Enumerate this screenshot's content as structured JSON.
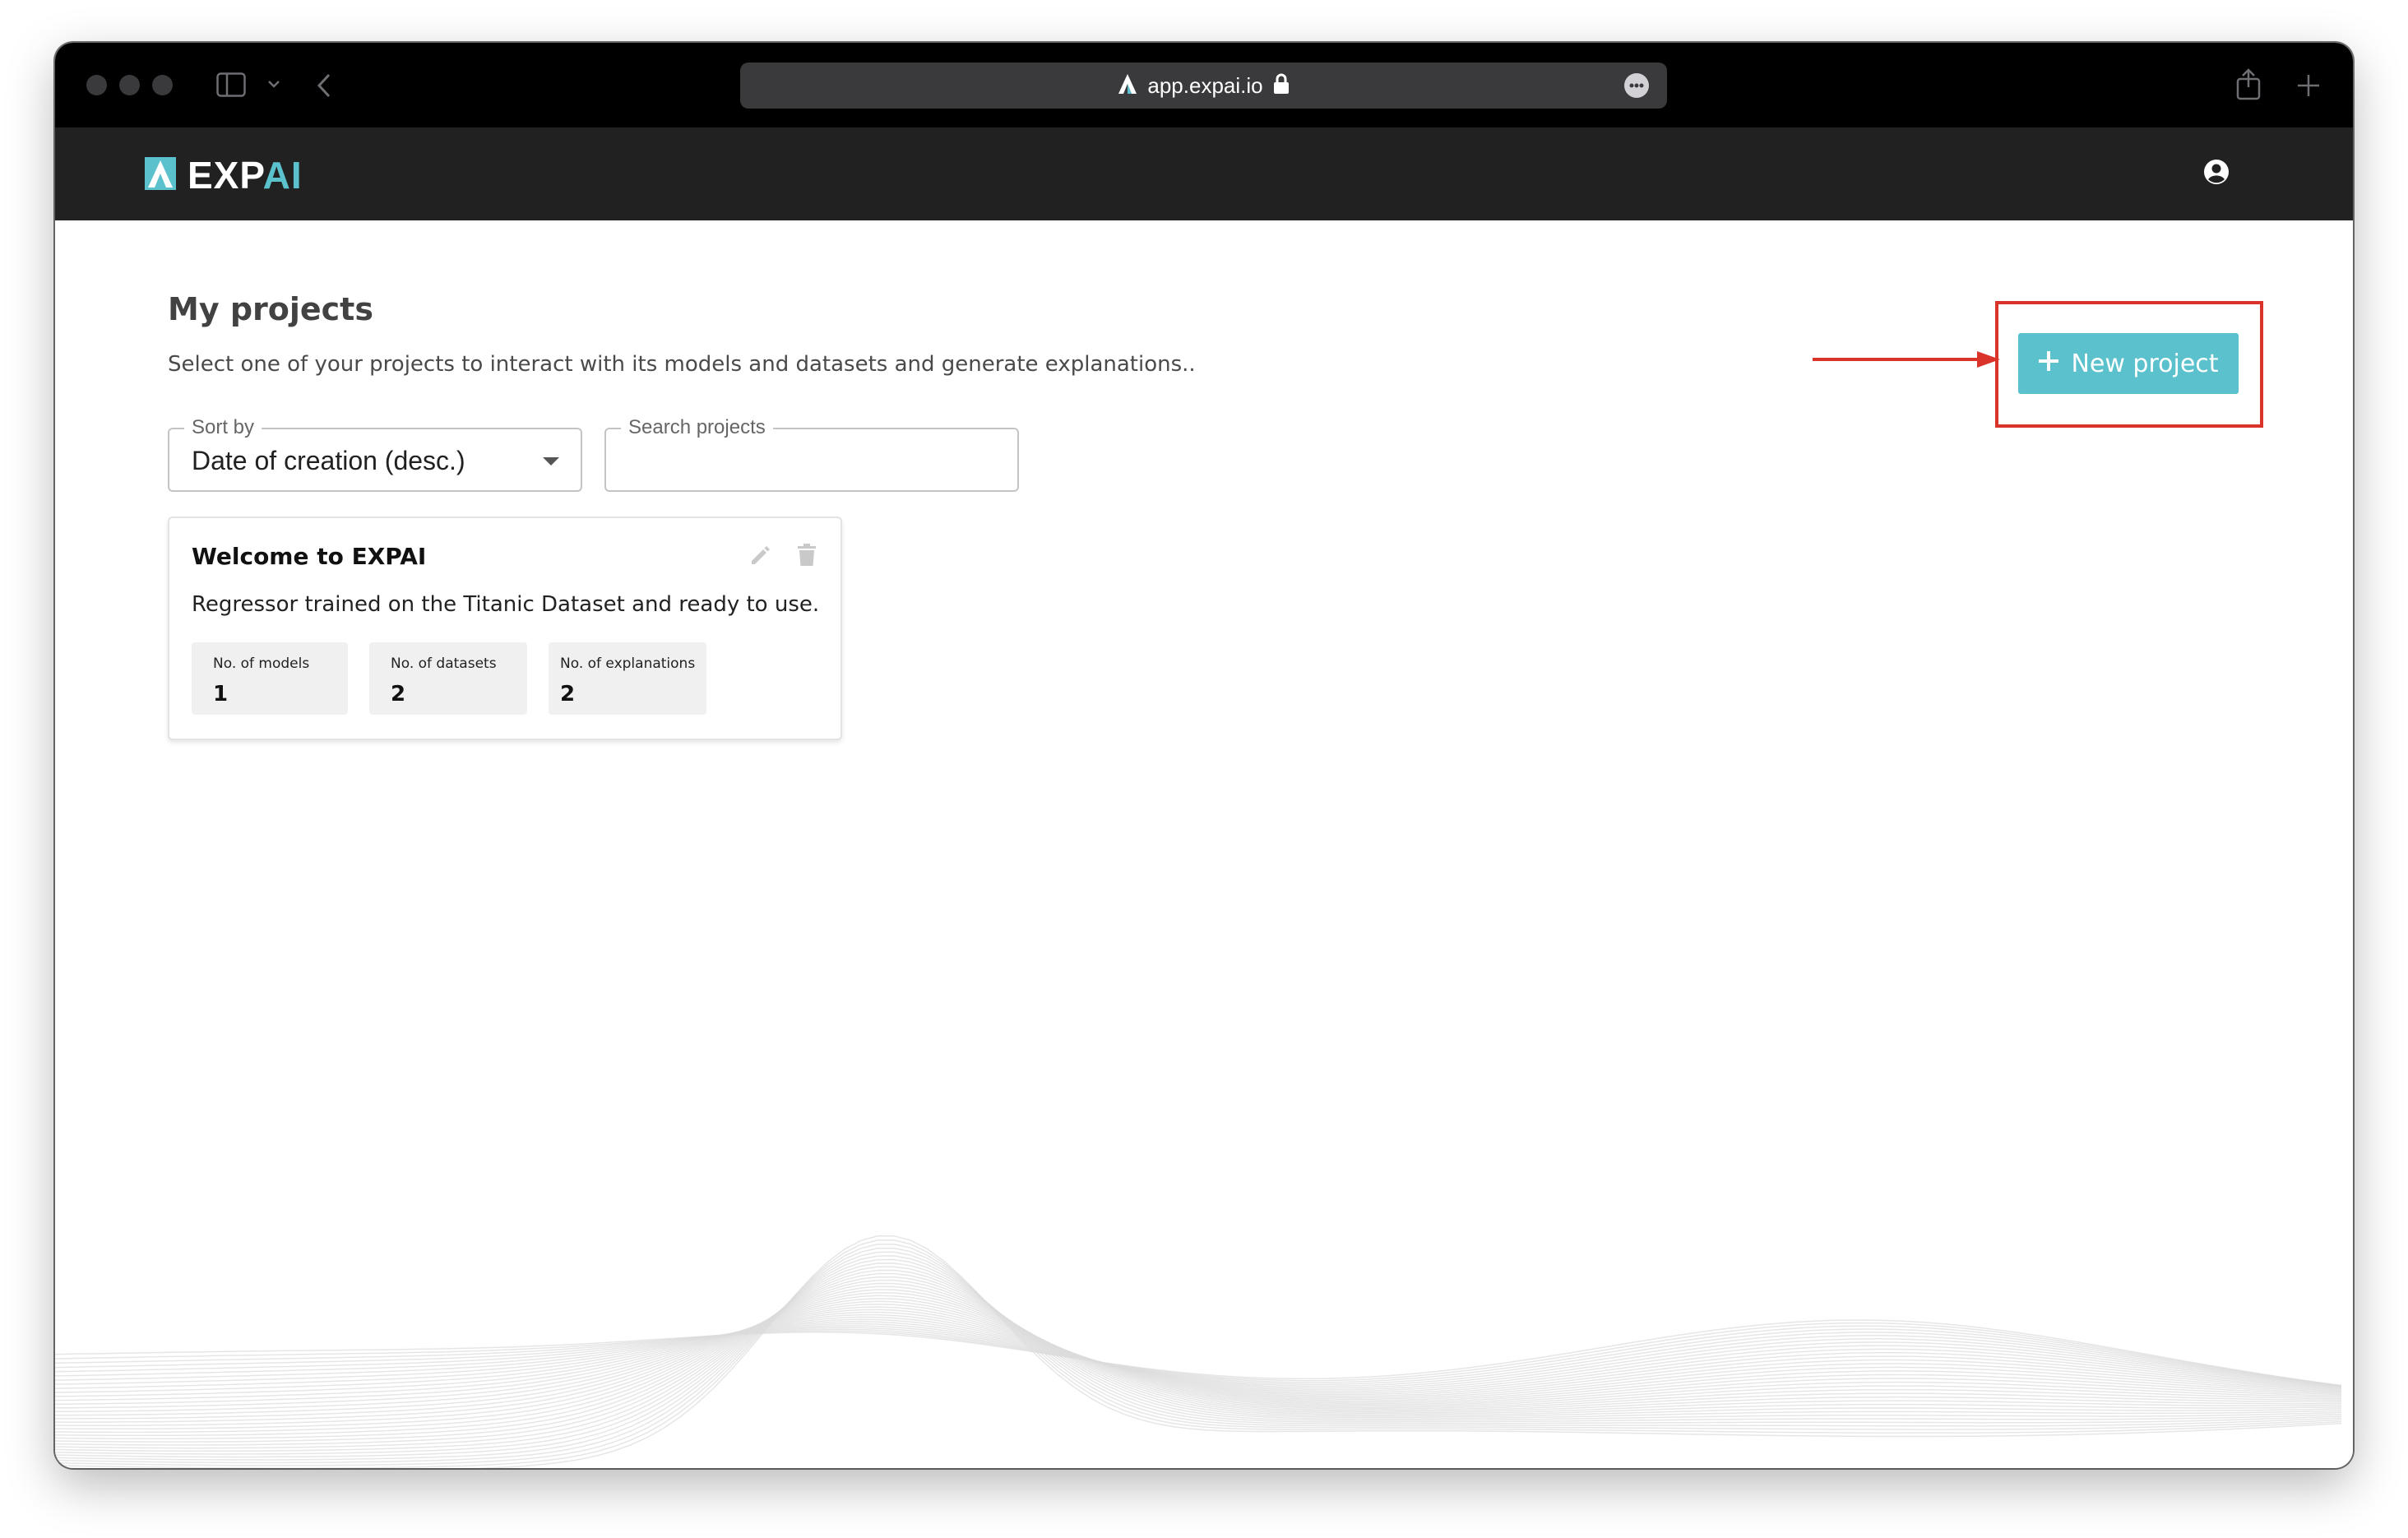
{
  "browser": {
    "url": "app.expai.io"
  },
  "app": {
    "logo_prefix": "EXP",
    "logo_accent": "AI",
    "brand_color": "#5bc1cc",
    "header_color": "#212121",
    "user_icon": "account-circle-icon"
  },
  "page": {
    "title": "My projects",
    "subtitle": "Select one of your projects to interact with its models and datasets and generate explanations.."
  },
  "controls": {
    "sort_label": "Sort by",
    "sort_value": "Date of creation (desc.)",
    "search_label": "Search projects",
    "search_value": "",
    "new_project_label": "New project"
  },
  "projects": [
    {
      "title": "Welcome to EXPAI",
      "description": "Regressor trained on the Titanic Dataset and ready to use.",
      "stats": [
        {
          "label": "No. of models",
          "value": "1"
        },
        {
          "label": "No. of datasets",
          "value": "2"
        },
        {
          "label": "No. of explanations",
          "value": "2"
        }
      ]
    }
  ],
  "annotation": {
    "highlight_color": "#d9332a"
  }
}
